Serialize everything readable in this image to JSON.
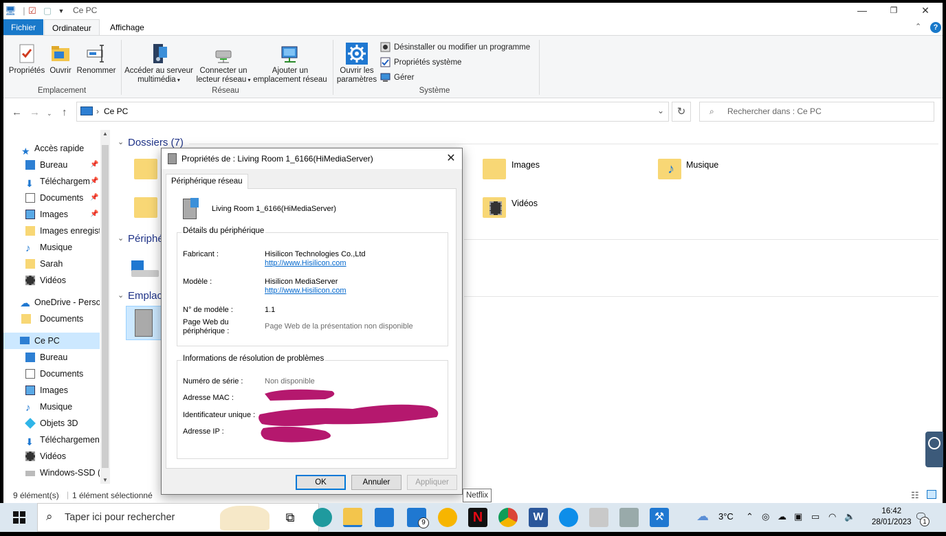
{
  "window": {
    "title": "Ce PC",
    "controls": {
      "minimize": "—",
      "maximize": "❐",
      "close": "✕"
    }
  },
  "ribbon_tabs": {
    "file": "Fichier",
    "computer": "Ordinateur",
    "view": "Affichage"
  },
  "ribbon": {
    "properties": "Propriétés",
    "open": "Ouvrir",
    "rename": "Renommer",
    "group_location": "Emplacement",
    "media_server": "Accéder au serveur",
    "media_server_2": "multimédia",
    "map_drive": "Connecter un",
    "map_drive_2": "lecteur réseau",
    "add_location": "Ajouter un",
    "add_location_2": "emplacement réseau",
    "group_network": "Réseau",
    "open_settings": "Ouvrir les",
    "open_settings_2": "paramètres",
    "uninstall": "Désinstaller ou modifier un programme",
    "system_props": "Propriétés système",
    "manage": "Gérer",
    "group_system": "Système"
  },
  "address": {
    "path": "Ce PC",
    "search_placeholder": "Rechercher dans : Ce PC"
  },
  "nav": {
    "quick_access": "Accès rapide",
    "items_quick": [
      "Bureau",
      "Téléchargements",
      "Documents",
      "Images",
      "Images enregistrées",
      "Musique",
      "Sarah",
      "Vidéos"
    ],
    "onedrive": "OneDrive - Personnel",
    "onedrive_docs": "Documents",
    "this_pc": "Ce PC",
    "items_pc": [
      "Bureau",
      "Documents",
      "Images",
      "Musique",
      "Objets 3D",
      "Téléchargements",
      "Vidéos",
      "Windows-SSD (C:)"
    ]
  },
  "content": {
    "folders_header": "Dossiers (7)",
    "devices_header": "Périphé",
    "network_header": "Emplac",
    "folder_images": "Images",
    "folder_music": "Musique",
    "folder_videos": "Vidéos"
  },
  "status": {
    "count": "9 élément(s)",
    "selected": "1 élément sélectionné"
  },
  "dialog": {
    "title": "Propriétés de : Living Room 1_6166(HiMediaServer)",
    "tab": "Périphérique réseau",
    "device_name": "Living Room 1_6166(HiMediaServer)",
    "details_legend": "Détails du périphérique",
    "manufacturer_label": "Fabricant :",
    "manufacturer_value": "Hisilicon Technologies Co.,Ltd",
    "manufacturer_link": "http://www.Hisilicon.com",
    "model_label": "Modèle :",
    "model_value": "Hisilicon MediaServer",
    "model_link": "http://www.Hisilicon.com",
    "model_number_label": "N° de modèle :",
    "model_number_value": "1.1",
    "webpage_label_1": "Page Web du",
    "webpage_label_2": "périphérique :",
    "webpage_value": "Page Web de la présentation non disponible",
    "troubleshoot_legend": "Informations de résolution de problèmes",
    "serial_label": "Numéro de série :",
    "serial_value": "Non disponible",
    "mac_label": "Adresse MAC :",
    "uid_label": "Identificateur unique :",
    "ip_label": "Adresse IP :",
    "ok": "OK",
    "cancel": "Annuler",
    "apply": "Appliquer"
  },
  "tooltip": "Netflix",
  "taskbar": {
    "search_placeholder": "Taper ici pour rechercher",
    "mail_badge": "9",
    "temperature": "3°C",
    "time": "16:42",
    "date": "28/01/2023",
    "notif_count": "1"
  }
}
